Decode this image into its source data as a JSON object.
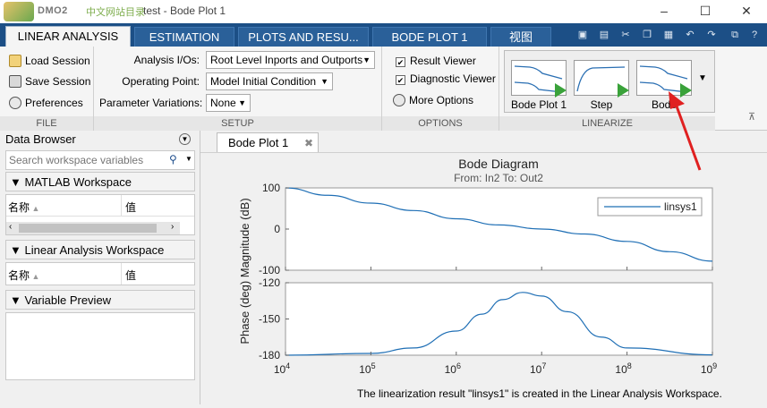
{
  "window": {
    "title": "test - Bode Plot 1",
    "watermark_brand": "DMO2",
    "watermark_cn": "中文网站目录",
    "min_glyph": "–",
    "max_glyph": "☐",
    "close_glyph": "✕"
  },
  "tabs": [
    {
      "label": "LINEAR ANALYSIS",
      "active": true
    },
    {
      "label": "ESTIMATION"
    },
    {
      "label": "PLOTS AND RESU..."
    },
    {
      "label": "BODE PLOT 1"
    },
    {
      "label": "视图"
    }
  ],
  "file_section": {
    "label": "FILE",
    "load_session": "Load Session",
    "save_session": "Save Session",
    "preferences": "Preferences"
  },
  "setup_section": {
    "label": "SETUP",
    "analysis_ios_label": "Analysis I/Os:",
    "analysis_ios_value": "Root Level Inports and Outports",
    "operating_point_label": "Operating Point:",
    "operating_point_value": "Model Initial Condition",
    "parameter_variations_label": "Parameter Variations:",
    "parameter_variations_value": "None"
  },
  "options_section": {
    "label": "OPTIONS",
    "result_viewer": "Result Viewer",
    "diagnostic_viewer": "Diagnostic Viewer",
    "more_options": "More Options",
    "result_viewer_checked": true,
    "diagnostic_viewer_checked": true
  },
  "linearize_section": {
    "label": "LINEARIZE",
    "items": [
      "Bode Plot 1",
      "Step",
      "Bode"
    ]
  },
  "data_browser": {
    "title": "Data Browser",
    "search_placeholder": "Search workspace variables",
    "matlab_workspace": "MATLAB Workspace",
    "col_name": "名称",
    "col_value": "值",
    "linear_workspace": "Linear Analysis Workspace",
    "variable_preview": "Variable Preview"
  },
  "document": {
    "tab_label": "Bode Plot 1"
  },
  "chart_data": {
    "type": "line",
    "title": "Bode Diagram",
    "subtitle": "From: In2  To: Out2",
    "xscale": "log",
    "xlim": [
      10000,
      1000000000
    ],
    "x_ticks": [
      {
        "base": "10",
        "exp": "4"
      },
      {
        "base": "10",
        "exp": "5"
      },
      {
        "base": "10",
        "exp": "6"
      },
      {
        "base": "10",
        "exp": "7"
      },
      {
        "base": "10",
        "exp": "8"
      },
      {
        "base": "10",
        "exp": "9"
      }
    ],
    "ylabel_shared": "Phase (deg)  Magnitude (dB)",
    "legend": "linsys1",
    "legend_position": "top-right",
    "magnitude": {
      "ylim": [
        -100,
        100
      ],
      "yticks": [
        "100",
        "0",
        "-100"
      ],
      "x": [
        10000,
        31623,
        100000,
        316228,
        1000000,
        3162278,
        10000000,
        31622777,
        100000000,
        316227766,
        1000000000
      ],
      "y": [
        100,
        82,
        63,
        45,
        25,
        10,
        0,
        -12,
        -30,
        -55,
        -78
      ]
    },
    "phase": {
      "ylim": [
        -180,
        -120
      ],
      "yticks": [
        "-120",
        "-150",
        "-180"
      ],
      "x": [
        10000,
        100000,
        316228,
        1000000,
        2000000,
        3500000,
        6000000,
        10000000,
        20000000,
        50000000,
        100000000,
        1000000000
      ],
      "y": [
        -180,
        -178.5,
        -174,
        -160,
        -146,
        -134,
        -128,
        -131,
        -144,
        -165,
        -174,
        -179.7
      ]
    },
    "series_color": "#1f6fb5"
  },
  "status": {
    "message": "The linearization result \"linsys1\" is created in the Linear Analysis Workspace."
  },
  "colors": {
    "ribbon_tabbar": "#1c4f86",
    "play_green": "#3aa23a",
    "line_blue": "#1f6fb5"
  }
}
